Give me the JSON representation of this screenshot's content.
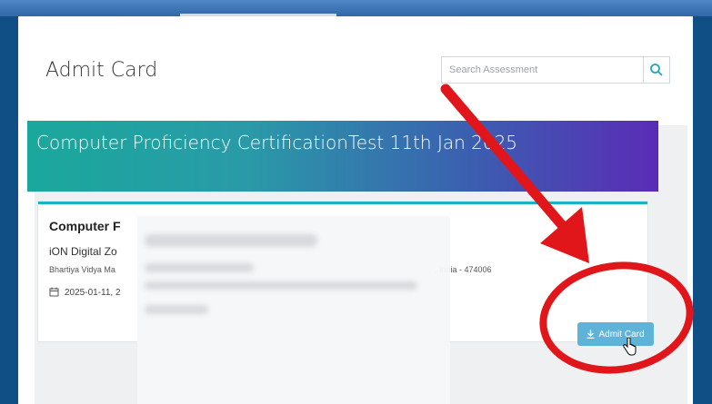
{
  "page": {
    "title": "Admit Card"
  },
  "search": {
    "placeholder": "Search Assessment",
    "icon": "search-icon"
  },
  "exam": {
    "banner_title": "Computer Proficiency CertificationTest 11th Jan 2025",
    "name_visible": "Computer F",
    "center_visible": "iON Digital Zo",
    "address_visible_start": "Bhartiya Vidya Ma",
    "address_visible_end": ", India - 474006",
    "date_visible": "2025-01-11, 2",
    "admit_card_label": "Admit Card"
  },
  "colors": {
    "accent": "#5eb4d8",
    "banner_start": "#1aa89c",
    "banner_end": "#5a2cb6",
    "annotation": "#e0161b"
  }
}
